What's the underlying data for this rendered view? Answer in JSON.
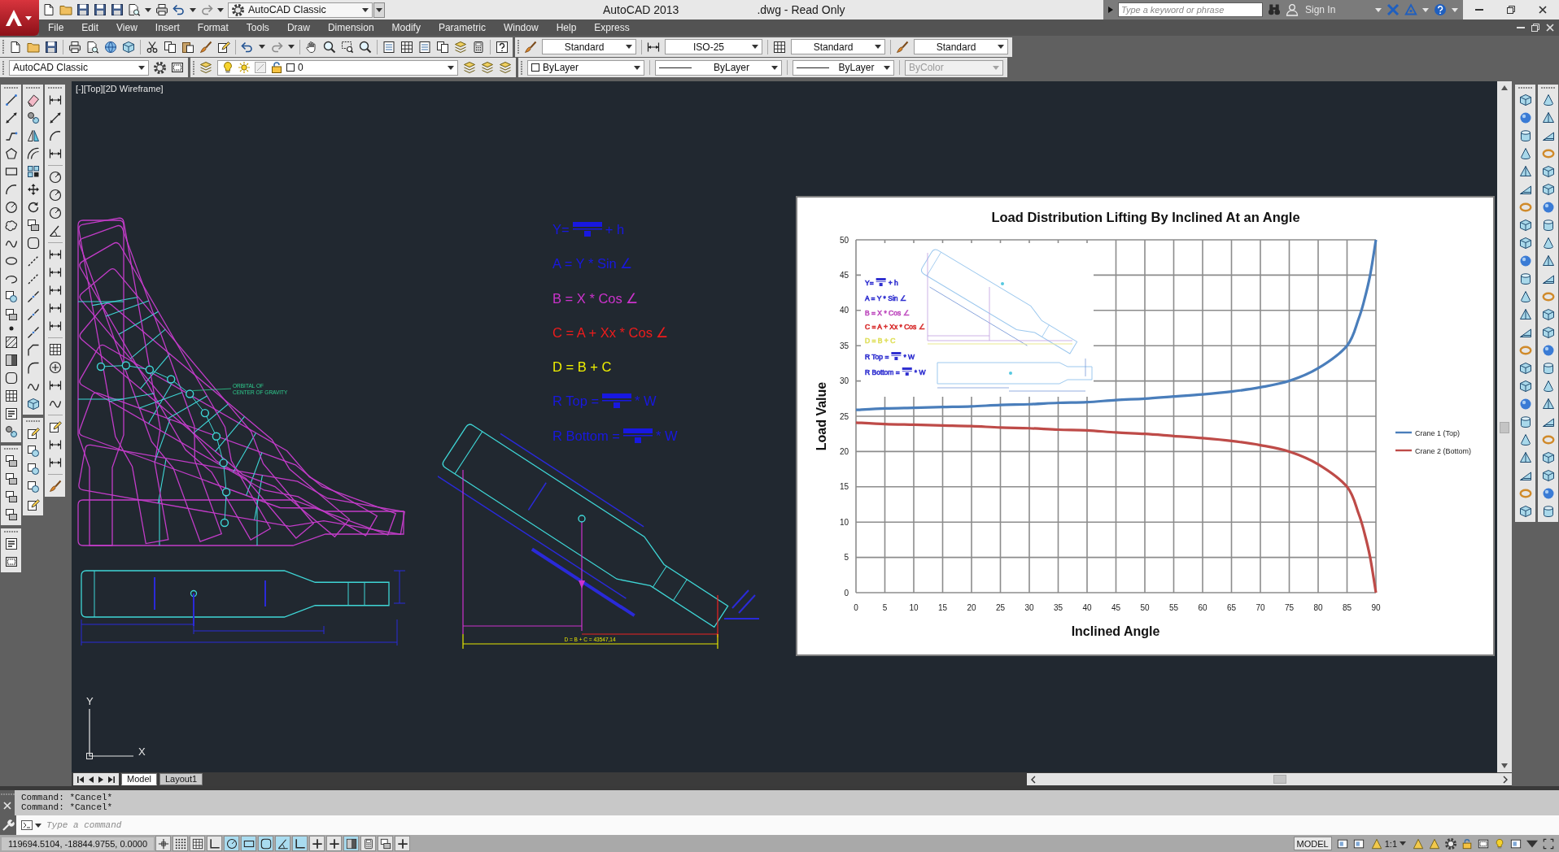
{
  "title_bar": {
    "workspace": "AutoCAD Classic",
    "app_title": "AutoCAD 2013",
    "document_title": ".dwg - Read Only",
    "search": {
      "placeholder": "Type a keyword or phrase"
    },
    "sign_in": "Sign In"
  },
  "menu_bar": [
    "File",
    "Edit",
    "View",
    "Insert",
    "Format",
    "Tools",
    "Draw",
    "Dimension",
    "Modify",
    "Parametric",
    "Window",
    "Help",
    "Express"
  ],
  "styles_toolbar": [
    {
      "kind": "text_style",
      "value": "Standard"
    },
    {
      "kind": "dimension_style",
      "value": "ISO-25"
    },
    {
      "kind": "table_style",
      "value": "Standard"
    },
    {
      "kind": "multileader_style",
      "value": "Standard"
    }
  ],
  "workspaces_toolbar": {
    "workspace": "AutoCAD Classic"
  },
  "layers_toolbar": {
    "layer": "0"
  },
  "properties_toolbar": [
    {
      "kind": "color",
      "value": "ByLayer",
      "disabled": false
    },
    {
      "kind": "linetype",
      "value": "ByLayer",
      "disabled": false
    },
    {
      "kind": "lineweight",
      "value": "ByLayer",
      "disabled": false
    },
    {
      "kind": "plot_style",
      "value": "ByColor",
      "disabled": true
    }
  ],
  "viewport": {
    "label": "[-][Top][2D Wireframe]",
    "formulas": [
      {
        "lead": "Y=",
        "fraction": true,
        "tail": "+ h",
        "color": "#1818e0"
      },
      {
        "lead": "A = Y * Sin ∠",
        "fraction": false,
        "color": "#1818e0"
      },
      {
        "lead": "B = X * Cos ∠",
        "fraction": false,
        "color": "#cc33cc"
      },
      {
        "lead": "C = A + Xx * Cos ∠",
        "fraction": false,
        "color": "#ee1c1c"
      },
      {
        "lead": "D = B + C",
        "fraction": false,
        "color": "#f0f000"
      },
      {
        "lead": "R Top =",
        "fraction": true,
        "tail": "* W",
        "color": "#1818e0"
      },
      {
        "lead": "R Bottom =",
        "fraction": true,
        "tail": "* W",
        "color": "#1818e0"
      }
    ],
    "annotation": [
      "ORBITAL OF",
      "CENTER OF GRAVITY"
    ],
    "dimension_label": "D = B + C = 43547,14",
    "ucs": {
      "x": "X",
      "y": "Y"
    },
    "chart": {
      "chart_data": {
        "type": "line",
        "title": "Load Distribution Lifting By Inclined At an Angle",
        "xlabel": "Inclined Angle",
        "ylabel": "Load Value",
        "x": [
          0,
          5,
          10,
          15,
          20,
          25,
          30,
          35,
          40,
          45,
          50,
          55,
          60,
          65,
          70,
          75,
          80,
          85,
          87,
          88,
          89,
          90
        ],
        "series": [
          {
            "name": "Crane 1 (Top)",
            "color": "#4a7ebb",
            "values": [
              25.9,
              26.1,
              26.2,
              26.3,
              26.4,
              26.6,
              26.7,
              26.9,
              27.0,
              27.3,
              27.5,
              27.8,
              28.1,
              28.5,
              29.1,
              30.0,
              31.8,
              35.0,
              38.8,
              41.5,
              45.0,
              50.0
            ]
          },
          {
            "name": "Crane 2 (Bottom)",
            "color": "#be4b48",
            "values": [
              24.1,
              23.9,
              23.8,
              23.7,
              23.6,
              23.4,
              23.3,
              23.1,
              23.0,
              22.7,
              22.5,
              22.2,
              21.9,
              21.5,
              20.9,
              20.0,
              18.2,
              15.0,
              11.2,
              8.5,
              5.0,
              0.0
            ]
          }
        ],
        "xlim": [
          0,
          90
        ],
        "ylim": [
          0,
          50
        ],
        "xticks": [
          0,
          5,
          10,
          15,
          20,
          25,
          30,
          35,
          40,
          45,
          50,
          55,
          60,
          65,
          70,
          75,
          80,
          85,
          90
        ],
        "yticks": [
          0,
          5,
          10,
          15,
          20,
          25,
          30,
          35,
          40,
          45,
          50
        ],
        "grid": true,
        "legend": true
      },
      "inset": {
        "formulas": [
          {
            "lead": "Y=",
            "fraction": true,
            "tail": "+ h",
            "color": "#3030d0"
          },
          {
            "lead": "A = Y * Sin ∠",
            "fraction": false,
            "color": "#3030d0"
          },
          {
            "lead": "B = X * Cos ∠",
            "fraction": false,
            "color": "#c050c0"
          },
          {
            "lead": "C = A + Xx * Cos ∠",
            "fraction": false,
            "color": "#d83030"
          },
          {
            "lead": "D = B + C",
            "fraction": false,
            "color": "#e0e060"
          },
          {
            "lead": "R Top =",
            "fraction": true,
            "tail": "* W",
            "color": "#3030d0"
          },
          {
            "lead": "R Bottom =",
            "fraction": true,
            "tail": "* W",
            "color": "#3030d0"
          }
        ]
      }
    }
  },
  "layout_tabs": [
    {
      "label": "Model",
      "selected": true
    },
    {
      "label": "Layout1",
      "selected": false
    }
  ],
  "command_history": [
    "Command: *Cancel*",
    "Command: *Cancel*"
  ],
  "command_line": {
    "placeholder": "Type a command"
  },
  "status_bar": {
    "coordinates": "119694.5104, -18844.9755, 0.0000",
    "toggles": [
      {
        "on": false
      },
      {
        "on": false
      },
      {
        "on": false
      },
      {
        "on": false
      },
      {
        "on": true
      },
      {
        "on": true
      },
      {
        "on": true
      },
      {
        "on": true
      },
      {
        "on": true
      },
      {
        "on": false
      },
      {
        "on": false
      },
      {
        "on": true
      },
      {
        "on": false
      },
      {
        "on": false
      },
      {
        "on": false
      }
    ],
    "space": "MODEL",
    "annotation_scale": "1:1"
  }
}
